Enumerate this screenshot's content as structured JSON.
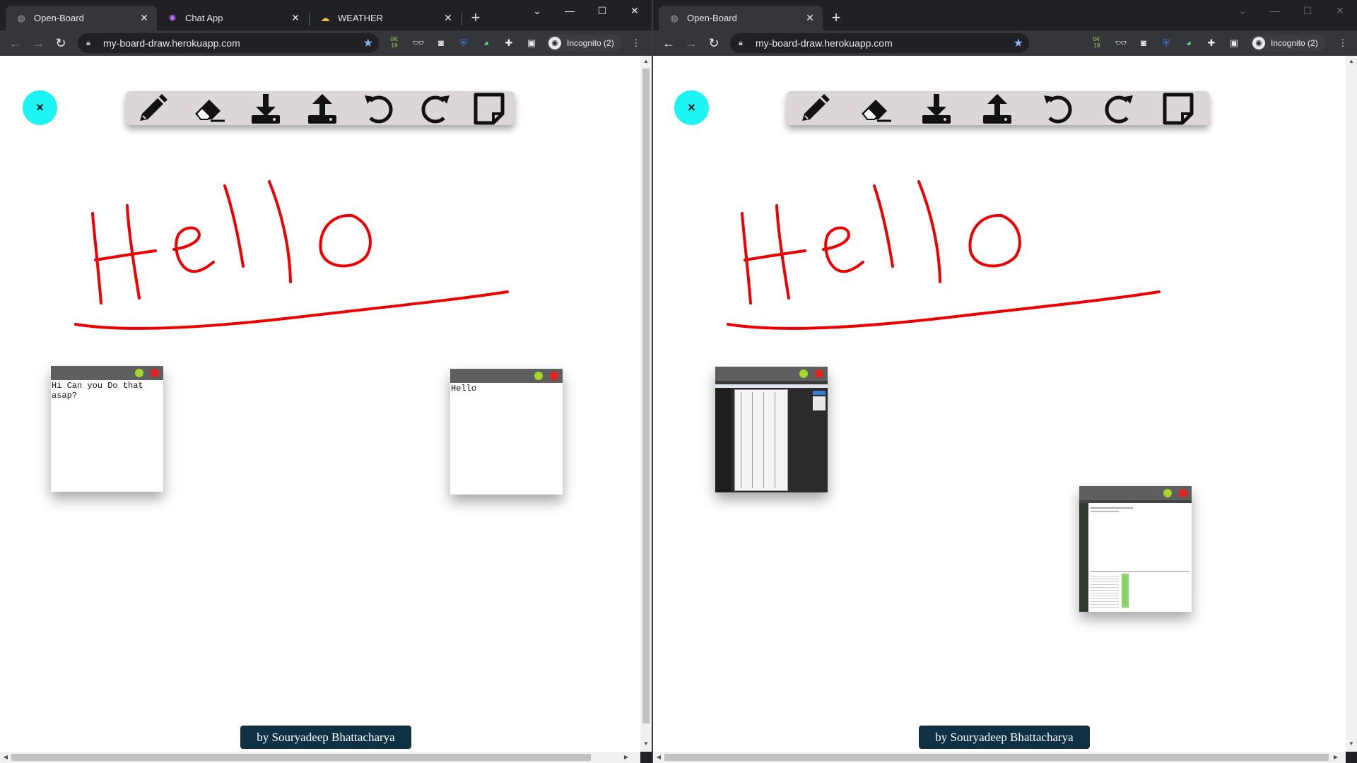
{
  "left_window": {
    "tabs": [
      {
        "title": "Open-Board",
        "favicon": "globe-icon"
      },
      {
        "title": "Chat App",
        "favicon": "chat-icon"
      },
      {
        "title": "WEATHER",
        "favicon": "weather-icon"
      }
    ],
    "url": "my-board-draw.herokuapp.com",
    "incognito_label": "Incognito (2)",
    "ext_badge_top": "04:",
    "ext_badge_bottom": "19",
    "sticky_notes": [
      {
        "text": "Hi Can you Do that asap?"
      },
      {
        "text": "Hello"
      }
    ],
    "credit": "by Souryadeep Bhattacharya"
  },
  "right_window": {
    "tabs": [
      {
        "title": "Open-Board",
        "favicon": "globe-icon"
      }
    ],
    "url": "my-board-draw.herokuapp.com",
    "incognito_label": "Incognito (2)",
    "ext_badge_top": "04:",
    "ext_badge_bottom": "19",
    "credit": "by Souryadeep Bhattacharya"
  },
  "menu_button_label": "×",
  "tools": [
    "pencil-icon",
    "eraser-icon",
    "download-icon",
    "upload-icon",
    "undo-icon",
    "redo-icon",
    "sticky-note-icon"
  ],
  "colors": {
    "pen": "#ee0000",
    "menu_button": "#1cf3f3",
    "toolbar_bg": "#dcd6d6",
    "sticky_bar": "#5f5f5f",
    "credit_bg": "#0e3145"
  }
}
